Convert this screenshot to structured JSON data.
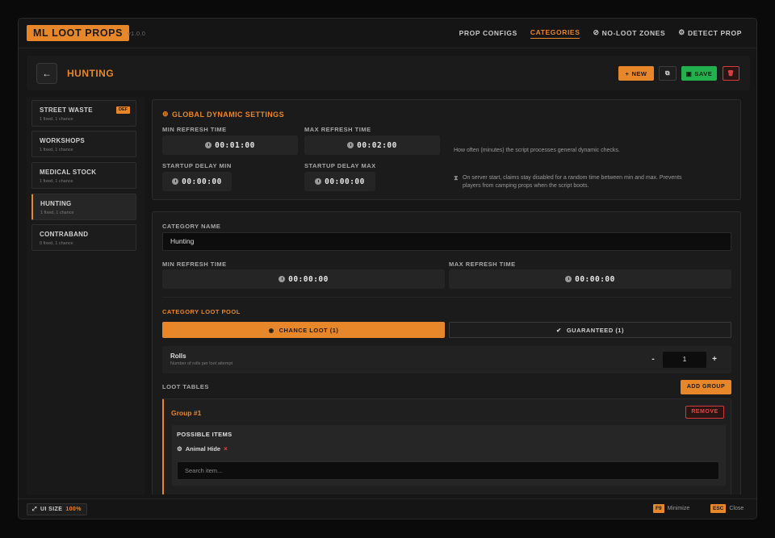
{
  "app": {
    "logo": "ML LOOT PROPS",
    "version": "v1.0.0"
  },
  "nav": [
    {
      "label": "PROP CONFIGS",
      "icon": "",
      "active": false
    },
    {
      "label": "CATEGORIES",
      "icon": "",
      "active": true
    },
    {
      "label": "NO-LOOT ZONES",
      "icon": "⊘",
      "active": false
    },
    {
      "label": "DETECT PROP",
      "icon": "⚙",
      "active": false
    }
  ],
  "header": {
    "title": "HUNTING",
    "back_icon": "←",
    "new_label": "NEW",
    "new_icon": "+",
    "copy_icon": "⧉",
    "save_label": "SAVE",
    "save_icon": "▣",
    "delete_icon": "🗑"
  },
  "sidebar": {
    "items": [
      {
        "name": "STREET WASTE",
        "sub": "1 fixed, 1 chance",
        "badge": "DEF"
      },
      {
        "name": "WORKSHOPS",
        "sub": "1 fixed, 1 chance"
      },
      {
        "name": "MEDICAL STOCK",
        "sub": "1 fixed, 1 chance"
      },
      {
        "name": "HUNTING",
        "sub": "1 fixed, 1 chance",
        "active": true
      },
      {
        "name": "CONTRABAND",
        "sub": "0 fixed, 1 chance"
      }
    ]
  },
  "global": {
    "title": "GLOBAL DYNAMIC SETTINGS",
    "title_icon": "⊕",
    "min_refresh_label": "MIN REFRESH TIME",
    "min_refresh_value": "00:01:00",
    "max_refresh_label": "MAX REFRESH TIME",
    "max_refresh_value": "00:02:00",
    "refresh_help": "How often (minutes) the script processes general dynamic checks.",
    "startup_min_label": "STARTUP DELAY MIN",
    "startup_min_value": "00:00:00",
    "startup_max_label": "STARTUP DELAY MAX",
    "startup_max_value": "00:00:00",
    "startup_help_icon": "⧗",
    "startup_help_line1": "On server start, claims stay disabled for a random time between min and max. Prevents",
    "startup_help_line2": "players from camping props when the script boots."
  },
  "category": {
    "name_label": "CATEGORY NAME",
    "name_value": "Hunting",
    "min_refresh_label": "MIN REFRESH TIME",
    "min_refresh_value": "00:00:00",
    "max_refresh_label": "MAX REFRESH TIME",
    "max_refresh_value": "00:00:00",
    "pool_title": "CATEGORY LOOT POOL",
    "tab_chance": "CHANCE LOOT (1)",
    "tab_chance_icon": "◉",
    "tab_guaranteed": "GUARANTEED (1)",
    "tab_guaranteed_icon": "✔",
    "rolls_label": "Rolls",
    "rolls_sub": "Number of rolls per loot attempt",
    "rolls_minus": "-",
    "rolls_value": "1",
    "rolls_plus": "+",
    "loot_tables_label": "LOOT TABLES",
    "add_group_label": "ADD GROUP",
    "group": {
      "title": "Group #1",
      "remove_label": "REMOVE",
      "items_title": "POSSIBLE ITEMS",
      "item_icon": "⚙",
      "item_name": "Animal Hide",
      "item_remove": "×",
      "search_placeholder": "Search item..."
    }
  },
  "footer": {
    "ui_size_icon": "⤢",
    "ui_size_label": "UI SIZE",
    "ui_size_value": "100%",
    "minimize_key": "F9",
    "minimize_label": "Minimize",
    "close_key": "ESC",
    "close_label": "Close"
  },
  "colors": {
    "accent": "#e8862a",
    "success": "#23b14d",
    "danger": "#e84545"
  }
}
